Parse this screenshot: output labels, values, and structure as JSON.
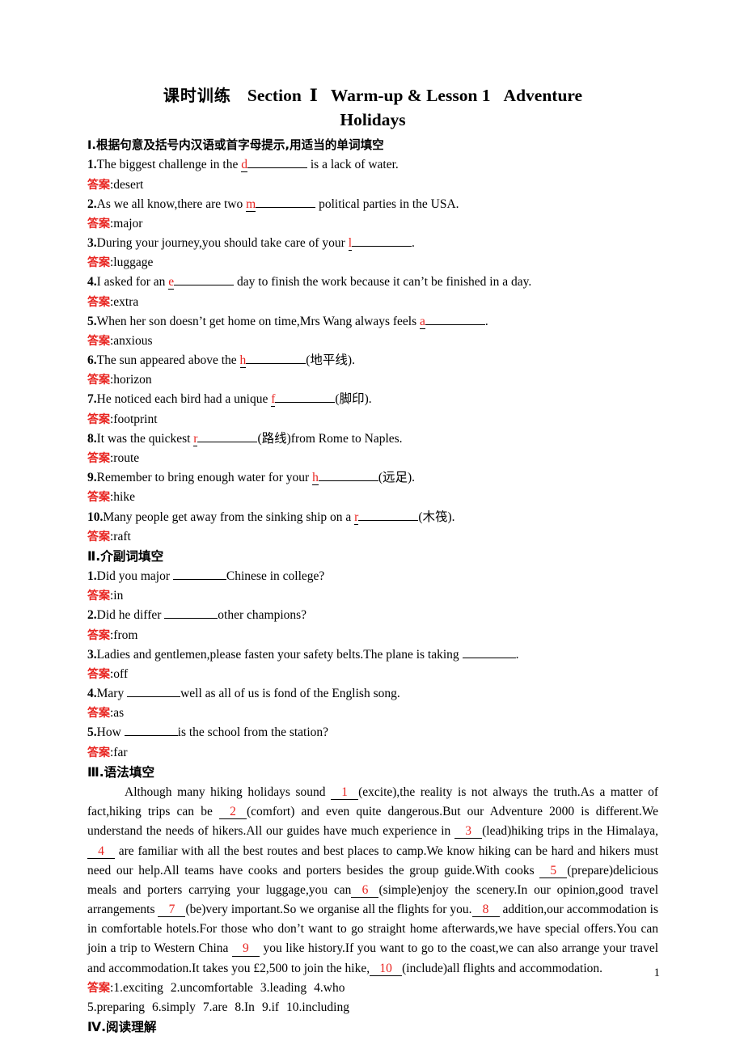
{
  "title": {
    "cn_prefix": "课时训练",
    "section_word": "Section",
    "section_num": "Ⅰ",
    "main": "Warm-up & Lesson 1",
    "sub": "Adventure",
    "line2": "Holidays"
  },
  "page_number": "1",
  "sections": [
    {
      "id": "section-1",
      "heading": "Ⅰ.根据句意及括号内汉语或首字母提示,用适当的单词填空",
      "answer_tag": "答案",
      "items": [
        {
          "num": "1.",
          "pre": "The biggest challenge in the ",
          "hint": "d",
          "post": " is a lack of water.",
          "answer": "desert"
        },
        {
          "num": "2.",
          "pre": "As we all know,there are two ",
          "hint": "m",
          "post": " political parties in the USA.",
          "answer": "major"
        },
        {
          "num": "3.",
          "pre": "During your journey,you should take care of your ",
          "hint": "l",
          "post": ".",
          "answer": "luggage"
        },
        {
          "num": "4.",
          "pre": "I asked for an ",
          "hint": "e",
          "post": " day to finish the work because it can’t be finished in a day.",
          "answer": "extra"
        },
        {
          "num": "5.",
          "pre": "When her son doesn’t get home on time,Mrs Wang always feels ",
          "hint": "a",
          "post": ".",
          "answer": "anxious"
        },
        {
          "num": "6.",
          "pre": "The sun appeared above the ",
          "hint": "h",
          "post": "(地平线).",
          "answer": "horizon"
        },
        {
          "num": "7.",
          "pre": "He noticed each bird had a unique ",
          "hint": "f",
          "post": "(脚印).",
          "answer": "footprint"
        },
        {
          "num": "8.",
          "pre": "It was the quickest ",
          "hint": "r",
          "post": "(路线)from Rome to Naples.",
          "answer": "route"
        },
        {
          "num": "9.",
          "pre": "Remember to bring enough water for your ",
          "hint": "h",
          "post": "(远足).",
          "answer": "hike"
        },
        {
          "num": "10.",
          "pre": "Many people get away from the sinking ship on a ",
          "hint": "r",
          "post": "(木筏).",
          "answer": "raft"
        }
      ]
    },
    {
      "id": "section-2",
      "heading": "Ⅱ.介副词填空",
      "answer_tag": "答案",
      "items": [
        {
          "num": "1.",
          "pre": "Did you major ",
          "hint": "",
          "post": "Chinese in college?",
          "answer": "in"
        },
        {
          "num": "2.",
          "pre": "Did he differ ",
          "hint": "",
          "post": "other champions?",
          "answer": "from"
        },
        {
          "num": "3.",
          "pre": "Ladies and gentlemen,please fasten your safety belts.The plane is taking ",
          "hint": "",
          "post": ".",
          "answer": "off"
        },
        {
          "num": "4.",
          "pre": "Mary ",
          "hint": "",
          "post": "well as all of us is fond of the English song.",
          "answer": "as"
        },
        {
          "num": "5.",
          "pre": "How ",
          "hint": "",
          "post": "is the school from the station?",
          "answer": "far"
        }
      ]
    }
  ],
  "section3": {
    "id": "section-3",
    "heading": "Ⅲ.语法填空",
    "answer_tag": "答案",
    "passage_parts": [
      {
        "type": "text",
        "value": "Although many hiking holidays sound "
      },
      {
        "type": "blank",
        "value": "1"
      },
      {
        "type": "text",
        "value": "(excite),the reality is not always the truth.As a matter of fact,hiking trips can be "
      },
      {
        "type": "blank",
        "value": "2"
      },
      {
        "type": "text",
        "value": "(comfort) and even quite dangerous.But our Adventure 2000 is different.We understand the needs of hikers.All our guides have much experience in "
      },
      {
        "type": "blank",
        "value": "3"
      },
      {
        "type": "text",
        "value": "(lead)hiking trips in the Himalaya,"
      },
      {
        "type": "blank",
        "value": "4"
      },
      {
        "type": "text",
        "value": " are familiar with all the best routes and best places to camp.We know hiking can be hard and hikers must need our help.All teams have cooks and porters besides the group guide.With cooks "
      },
      {
        "type": "blank",
        "value": "5"
      },
      {
        "type": "text",
        "value": "(prepare)delicious meals and porters carrying your luggage,you can"
      },
      {
        "type": "blank",
        "value": "6"
      },
      {
        "type": "text",
        "value": "(simple)enjoy the scenery.In our opinion,good travel arrangements "
      },
      {
        "type": "blank",
        "value": "7"
      },
      {
        "type": "text",
        "value": "(be)very important.So we organise all the flights for you."
      },
      {
        "type": "blank",
        "value": "8"
      },
      {
        "type": "text",
        "value": " addition,our accommodation is in comfortable hotels.For those who don’t want to go straight home afterwards,we have special offers.You can join a trip to Western China "
      },
      {
        "type": "blank",
        "value": "9"
      },
      {
        "type": "text",
        "value": " you like history.If you want to go to the coast,we can also arrange your travel and accommodation.It takes you £2,500 to join the hike,"
      },
      {
        "type": "blank",
        "value": "10"
      },
      {
        "type": "text",
        "value": "(include)all flights and accommodation."
      }
    ],
    "answers_row1": [
      "1.exciting",
      "2.uncomfortable",
      "3.leading",
      "4.who"
    ],
    "answers_row2": [
      "5.preparing",
      "6.simply",
      "7.are",
      "8.In",
      "9.if",
      "10.including"
    ]
  },
  "section4": {
    "id": "section-4",
    "heading": "Ⅳ.阅读理解"
  },
  "colors": {
    "red": "#e8231f",
    "text": "#000000",
    "background": "#ffffff"
  }
}
